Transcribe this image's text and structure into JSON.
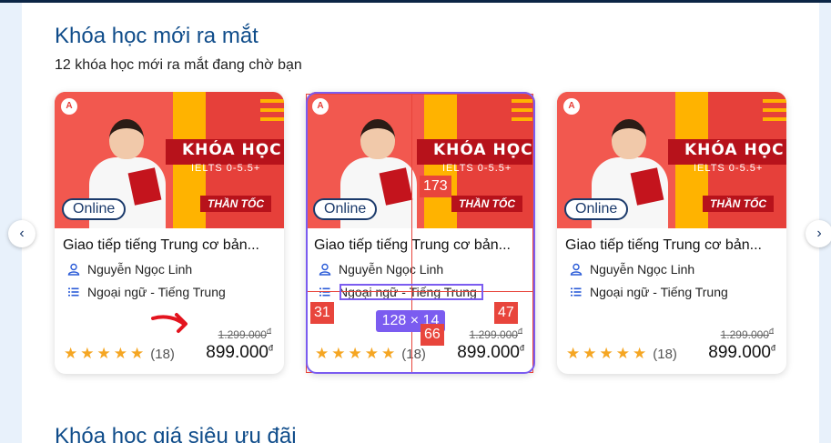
{
  "section1": {
    "title": "Khóa học mới ra mắt",
    "subtitle": "12 khóa học mới ra mắt đang chờ bạn"
  },
  "section2": {
    "title": "Khóa học giá siêu ưu đãi"
  },
  "nav": {
    "prev_icon": "chevron-left-icon",
    "next_icon": "chevron-right-icon",
    "prev": "‹",
    "next": "›"
  },
  "cards": [
    {
      "thumb": {
        "heading": "KHÓA HỌC",
        "sub": "IELTS 0-5.5+",
        "speed": "THẦN TỐC",
        "logo": "A",
        "badge": "Online"
      },
      "title": "Giao tiếp tiếng Trung cơ bản...",
      "teacher": "Nguyễn Ngọc Linh",
      "category": "Ngoại ngữ - Tiếng Trung",
      "old_price": "1.299.000",
      "price": "899.000",
      "currency": "đ",
      "rating": 5,
      "review_count": "(18)"
    },
    {
      "thumb": {
        "heading": "KHÓA HỌC",
        "sub": "IELTS 0-5.5+",
        "speed": "THẦN TỐC",
        "logo": "A",
        "badge": "Online"
      },
      "title": "Giao tiếp tiếng Trung cơ bản...",
      "teacher": "Nguyễn Ngọc Linh",
      "category": "Ngoại ngữ - Tiếng Trung",
      "old_price": "1.299.000",
      "price": "899.000",
      "currency": "đ",
      "rating": 5,
      "review_count": "(18)"
    },
    {
      "thumb": {
        "heading": "KHÓA HỌC",
        "sub": "IELTS 0-5.5+",
        "speed": "THẦN TỐC",
        "logo": "A",
        "badge": "Online"
      },
      "title": "Giao tiếp tiếng Trung cơ bản...",
      "teacher": "Nguyễn Ngọc Linh",
      "category": "Ngoại ngữ - Tiếng Trung",
      "old_price": "1.299.000",
      "price": "899.000",
      "currency": "đ",
      "rating": 5,
      "review_count": "(18)"
    }
  ],
  "overlay": {
    "tag_top": "173",
    "tag_left": "31",
    "tag_right": "47",
    "tag_bottom": "66",
    "dimension": "128 × 14"
  },
  "colors": {
    "accent": "#0f4c8a",
    "star": "#f5a623",
    "overlay_red": "#e8453c",
    "overlay_purple": "#7b5cf0"
  }
}
